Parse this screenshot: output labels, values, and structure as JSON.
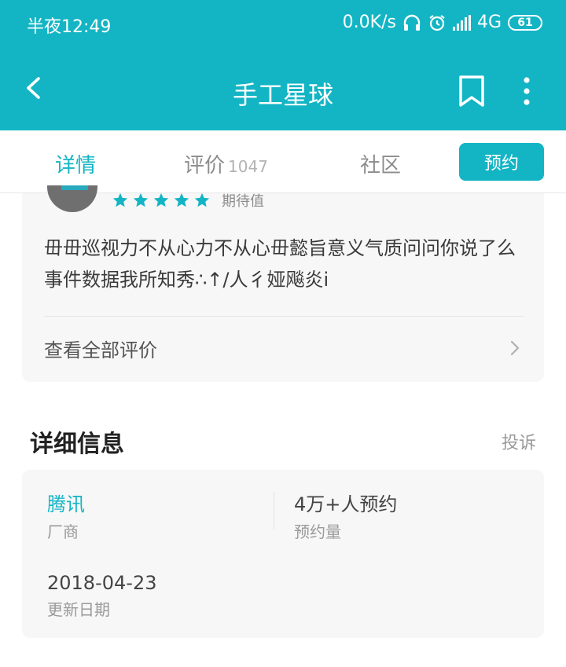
{
  "status_bar": {
    "time": "半夜12:49",
    "network_speed": "0.0K/s",
    "network_type": "4G",
    "battery": "61"
  },
  "app_bar": {
    "title": "手工星球"
  },
  "tabs": [
    {
      "label": "详情",
      "active": true
    },
    {
      "label": "评价",
      "count": "1047"
    },
    {
      "label": "社区"
    }
  ],
  "book_button": "预约",
  "review": {
    "rating_label": "期待值",
    "stars": 5,
    "text": "毌毌巡视力不从心力不从心毌懿旨意义气质问问你说了么事件数据我所知秀∴↑/人彳娅飚炎i",
    "view_all": "查看全部评价"
  },
  "details": {
    "title": "详细信息",
    "complain": "投诉",
    "vendor_value": "腾讯",
    "vendor_label": "厂商",
    "reservations_value": "4万+人预约",
    "reservations_label": "预约量",
    "update_value": "2018-04-23",
    "update_label": "更新日期"
  },
  "colors": {
    "brand": "#13b5c4",
    "card_bg": "#f7f7f7"
  }
}
